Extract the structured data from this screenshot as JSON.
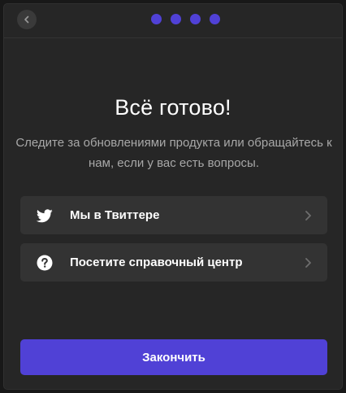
{
  "header": {
    "back_icon": "chevron-left-icon",
    "step_dots": 4,
    "accent_color": "#5041d6"
  },
  "main": {
    "title": "Всё готово!",
    "subtitle": "Следите за обновлениями продукта или обращайтесь к нам, если у вас есть вопросы."
  },
  "links": [
    {
      "label": "Мы в Твиттере",
      "icon": "twitter-icon"
    },
    {
      "label": "Посетите справочный центр",
      "icon": "help-circle-icon"
    }
  ],
  "footer": {
    "finish_label": "Закончить",
    "button_color": "#5041d6"
  }
}
